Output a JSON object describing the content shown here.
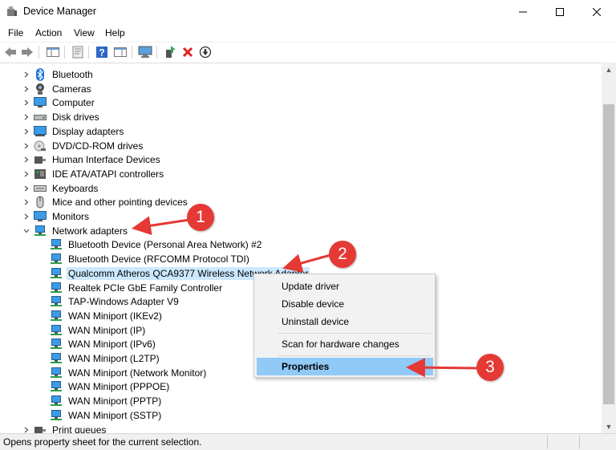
{
  "window": {
    "title": "Device Manager"
  },
  "menu": [
    "File",
    "Action",
    "View",
    "Help"
  ],
  "tree": {
    "categories_top": [
      {
        "label": "Bluetooth",
        "icon": "bluetooth-icon"
      },
      {
        "label": "Cameras",
        "icon": "camera-icon"
      },
      {
        "label": "Computer",
        "icon": "computer-icon"
      },
      {
        "label": "Disk drives",
        "icon": "disk-drive-icon"
      },
      {
        "label": "Display adapters",
        "icon": "display-adapter-icon"
      },
      {
        "label": "DVD/CD-ROM drives",
        "icon": "dvd-drive-icon"
      },
      {
        "label": "Human Interface Devices",
        "icon": "hid-icon"
      },
      {
        "label": "IDE ATA/ATAPI controllers",
        "icon": "ide-controller-icon"
      },
      {
        "label": "Keyboards",
        "icon": "keyboard-icon"
      },
      {
        "label": "Mice and other pointing devices",
        "icon": "mouse-icon"
      },
      {
        "label": "Monitors",
        "icon": "monitor-icon"
      }
    ],
    "expanded_category": {
      "label": "Network adapters",
      "icon": "network-adapter-icon"
    },
    "network_adapters": [
      "Bluetooth Device (Personal Area Network) #2",
      "Bluetooth Device (RFCOMM Protocol TDI)",
      "Qualcomm Atheros QCA9377 Wireless Network Adapter",
      "Realtek PCIe GbE Family Controller",
      "TAP-Windows Adapter V9",
      "WAN Miniport (IKEv2)",
      "WAN Miniport (IP)",
      "WAN Miniport (IPv6)",
      "WAN Miniport (L2TP)",
      "WAN Miniport (Network Monitor)",
      "WAN Miniport (PPPOE)",
      "WAN Miniport (PPTP)",
      "WAN Miniport (SSTP)"
    ],
    "selected_index": 2,
    "partial_next": "Print queues"
  },
  "context_menu": {
    "items": [
      "Update driver",
      "Disable device",
      "Uninstall device",
      "Scan for hardware changes",
      "Properties"
    ],
    "highlighted": "Properties"
  },
  "annotations": [
    "1",
    "2",
    "3"
  ],
  "status": {
    "text": "Opens property sheet for the current selection."
  },
  "colors": {
    "selection": "#cce8ff",
    "menu_highlight": "#91c9f7",
    "annotation": "#e53935"
  }
}
